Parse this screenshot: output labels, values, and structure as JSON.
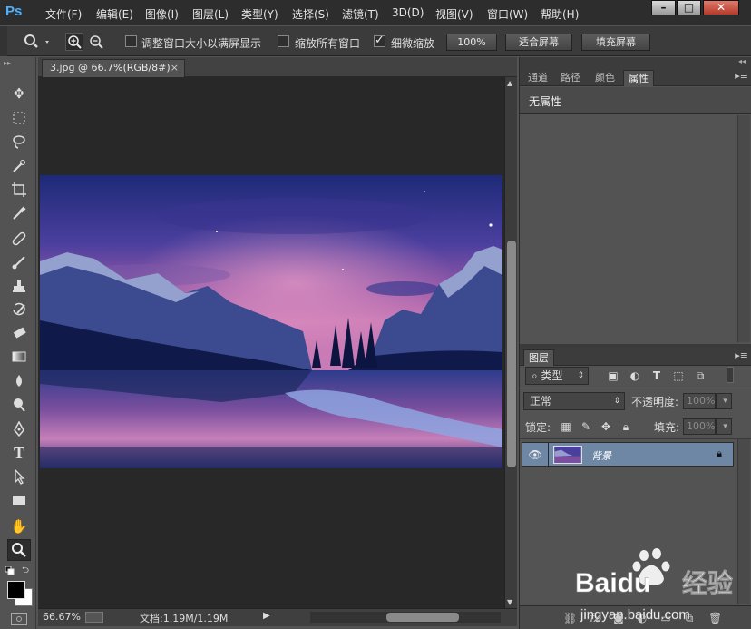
{
  "app": {
    "logo": "Ps"
  },
  "menu": [
    "文件(F)",
    "编辑(E)",
    "图像(I)",
    "图层(L)",
    "类型(Y)",
    "选择(S)",
    "滤镜(T)",
    "3D(D)",
    "视图(V)",
    "窗口(W)",
    "帮助(H)"
  ],
  "window_controls": {
    "minimize": "–",
    "maximize": "□",
    "close": "✕"
  },
  "options": {
    "resize_windows_label": "调整窗口大小以满屏显示",
    "resize_windows_checked": false,
    "zoom_all_windows_label": "缩放所有窗口",
    "zoom_all_windows_checked": false,
    "scrubby_zoom_label": "细微缩放",
    "scrubby_zoom_checked": true,
    "zoom_100_label": "100%",
    "fit_screen_label": "适合屏幕",
    "fill_screen_label": "填充屏幕"
  },
  "document": {
    "tab_title": "3.jpg @ 66.7%(RGB/8#)",
    "tab_close": "×"
  },
  "status": {
    "zoom": "66.67%",
    "doc_info": "文档:1.19M/1.19M"
  },
  "properties_panel": {
    "tabs": [
      "通道",
      "路径",
      "颜色",
      "属性"
    ],
    "selected_tab": "属性",
    "content": "无属性"
  },
  "layers_panel": {
    "tab": "图层",
    "filter_kind": "类型",
    "blend_mode": "正常",
    "opacity_label": "不透明度:",
    "opacity_value": "100%",
    "lock_label": "锁定:",
    "fill_label": "填充:",
    "fill_value": "100%",
    "layers": [
      {
        "name": "背景",
        "visible": true,
        "locked": true
      }
    ]
  },
  "watermark": {
    "brand": "Baidu",
    "text": "经验",
    "url": "jingyan.baidu.com"
  },
  "colors": {
    "accent": "#4db0ff",
    "layer_selected": "#6e87a5",
    "canvas_bg": "#282828",
    "panel_bg": "#535353"
  }
}
